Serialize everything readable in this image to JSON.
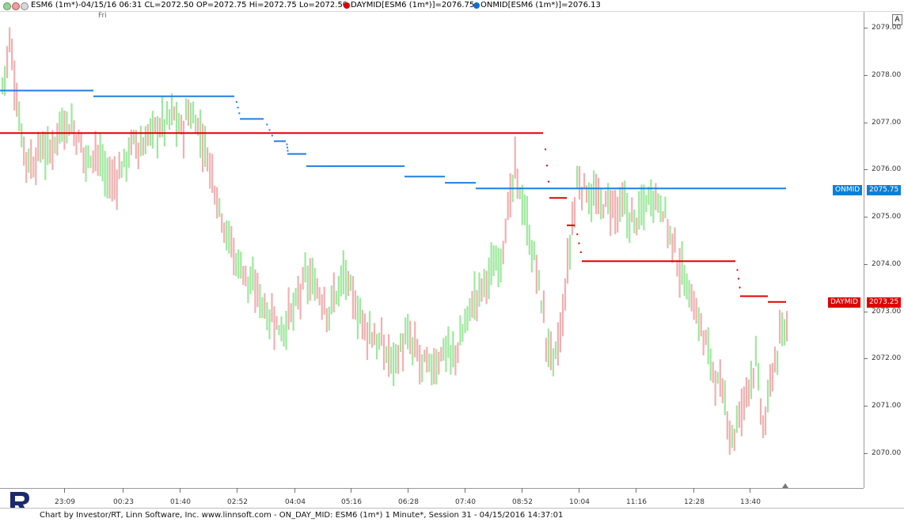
{
  "header": {
    "symbol_info": "ESM6 (1m*)-04/15/16 06:31 CL=2072.50 OP=2072.75 Hi=2072.75 Lo=2072.50",
    "daymid": "DAYMID[ESM6 (1m*)]=2076.75",
    "onmid": "ONMID[ESM6 (1m*)]=2076.13"
  },
  "day_label": "Fri",
  "y_axis": {
    "labels": [
      "2079.00",
      "2078.00",
      "2077.00",
      "2076.00",
      "2075.00",
      "2074.00",
      "2073.00",
      "2072.00",
      "2071.00",
      "2070.00"
    ],
    "button": "A"
  },
  "x_axis": {
    "labels": [
      "23:09",
      "00:23",
      "01:40",
      "02:52",
      "04:04",
      "05:16",
      "06:28",
      "07:40",
      "08:52",
      "10:04",
      "11:16",
      "12:28",
      "13:40"
    ]
  },
  "indicators": {
    "onmid": {
      "name": "ONMID",
      "value": "2075.75",
      "color": "#0a7fd8"
    },
    "daymid": {
      "name": "DAYMID",
      "value": "2073.25",
      "color": "#e00000"
    }
  },
  "colors": {
    "up_bar": "#9de89d",
    "down_bar": "#f0b0b0",
    "onmid_line": "#1f7fe0",
    "daymid_line": "#e00000"
  },
  "footer": {
    "text": "Chart by Investor/RT, Linn Software, Inc. www.linnsoft.com - ON_DAY_MID: ESM6 (1m*) 1 Minute*, Session 31 - 04/15/2016 14:37:01"
  },
  "chart_data": {
    "type": "bar",
    "ylim": [
      2069.4,
      2079.25
    ],
    "y_ticks": [
      2079,
      2078,
      2077,
      2076,
      2075,
      2074,
      2073,
      2072,
      2071,
      2070
    ],
    "x_labels": [
      "23:09",
      "00:23",
      "01:40",
      "02:52",
      "04:04",
      "05:16",
      "06:28",
      "07:40",
      "08:52",
      "10:04",
      "11:16",
      "12:28",
      "13:40"
    ],
    "price_path": [
      2077.8,
      2078.7,
      2077.2,
      2076.3,
      2076.1,
      2076.5,
      2076.3,
      2076.8,
      2077.0,
      2076.9,
      2076.5,
      2076.2,
      2076.5,
      2076.0,
      2075.7,
      2075.9,
      2076.3,
      2076.6,
      2076.4,
      2076.8,
      2076.9,
      2077.0,
      2077.2,
      2076.8,
      2077.2,
      2077.0,
      2076.5,
      2075.9,
      2075.2,
      2074.6,
      2074.1,
      2073.9,
      2073.5,
      2073.4,
      2073.0,
      2072.8,
      2072.6,
      2072.9,
      2073.2,
      2073.7,
      2073.6,
      2073.3,
      2073.0,
      2073.4,
      2073.8,
      2073.3,
      2072.9,
      2072.6,
      2072.4,
      2072.2,
      2072.0,
      2072.1,
      2072.4,
      2072.2,
      2071.9,
      2071.8,
      2071.9,
      2072.3,
      2072.0,
      2072.4,
      2073.0,
      2073.3,
      2073.6,
      2073.9,
      2074.1,
      2074.9,
      2076.0,
      2075.3,
      2074.4,
      2073.7,
      2072.4,
      2071.9,
      2072.6,
      2074.3,
      2075.7,
      2075.6,
      2075.4,
      2075.2,
      2075.3,
      2075.1,
      2075.2,
      2074.9,
      2075.0,
      2075.4,
      2075.5,
      2075.2,
      2074.6,
      2074.0,
      2073.6,
      2073.1,
      2072.6,
      2072.1,
      2071.5,
      2071.0,
      2070.3,
      2070.8,
      2071.5,
      2071.9,
      2070.4,
      2071.6,
      2072.3,
      2072.6
    ],
    "series": [
      {
        "name": "ONMID",
        "value": 2075.75,
        "steps": [
          {
            "x0": 0,
            "x1": 118,
            "y": 2077.67
          },
          {
            "x0": 118,
            "x1": 296,
            "y": 2077.55
          },
          {
            "x0": 303,
            "x1": 333,
            "y": 2077.07
          },
          {
            "x0": 346,
            "x1": 361,
            "y": 2076.6
          },
          {
            "x0": 363,
            "x1": 387,
            "y": 2076.33
          },
          {
            "x0": 387,
            "x1": 511,
            "y": 2076.07
          },
          {
            "x0": 511,
            "x1": 562,
            "y": 2075.85
          },
          {
            "x0": 562,
            "x1": 601,
            "y": 2075.72
          },
          {
            "x0": 601,
            "x1": 993,
            "y": 2075.6
          }
        ]
      },
      {
        "name": "DAYMID",
        "value": 2073.25,
        "steps": [
          {
            "x0": 0,
            "x1": 686,
            "y": 2076.77
          },
          {
            "x0": 694,
            "x1": 716,
            "y": 2075.4
          },
          {
            "x0": 716,
            "x1": 726,
            "y": 2074.82
          },
          {
            "x0": 735,
            "x1": 929,
            "y": 2074.06
          },
          {
            "x0": 935,
            "x1": 970,
            "y": 2073.32
          },
          {
            "x0": 970,
            "x1": 993,
            "y": 2073.2
          }
        ]
      }
    ]
  }
}
